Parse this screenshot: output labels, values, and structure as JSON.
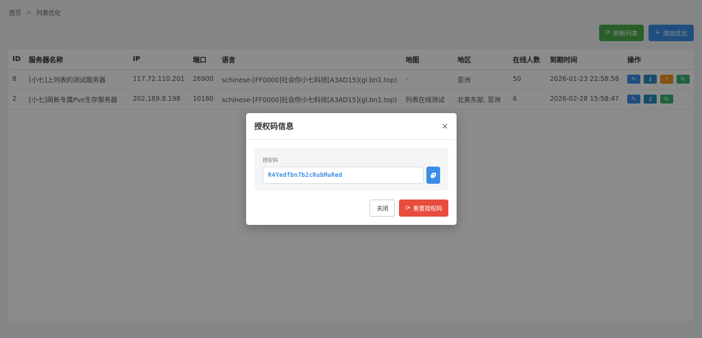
{
  "breadcrumb": {
    "home": "首页",
    "current": "列表优化"
  },
  "toolbar": {
    "refresh_label": "刷新列表",
    "add_label": "添加优化"
  },
  "table": {
    "headers": [
      "ID",
      "服务器名称",
      "IP",
      "端口",
      "语言",
      "地图",
      "地区",
      "在线人数",
      "到期时间",
      "操作"
    ],
    "rows": [
      {
        "id": "8",
        "name": "[小七]上列表的测试服务器",
        "ip": "117.72.110.201",
        "port": "26900",
        "language": "schinese-[FF0000]社会你小七科技[A3AD15](gl.bn1.top)",
        "map": "-",
        "region": "亚洲",
        "online": "50",
        "expire": "2026-01-23 22:58:58"
      },
      {
        "id": "2",
        "name": "[小七]萌新专属Pve生存服务器",
        "ip": "202.189.8.198",
        "port": "10180",
        "language": "schinese-[FF0000]社会你小七科技[A3AD15](gl.bn1.top)",
        "map": "列表在线测试",
        "region": "北美东部, 亚洲",
        "online": "6",
        "expire": "2026-02-28 15:58:47"
      }
    ]
  },
  "modal": {
    "title": "授权码信息",
    "close_glyph": "×",
    "code_label": "授权码",
    "code_value": "R4Yedfbn7b2cRubMuRed",
    "close_button": "关闭",
    "reset_button": "重置授权码"
  },
  "colors": {
    "primary": "#3a8ee6",
    "success": "#4cae4c",
    "danger": "#e74c3c",
    "warning": "#f0961e"
  }
}
